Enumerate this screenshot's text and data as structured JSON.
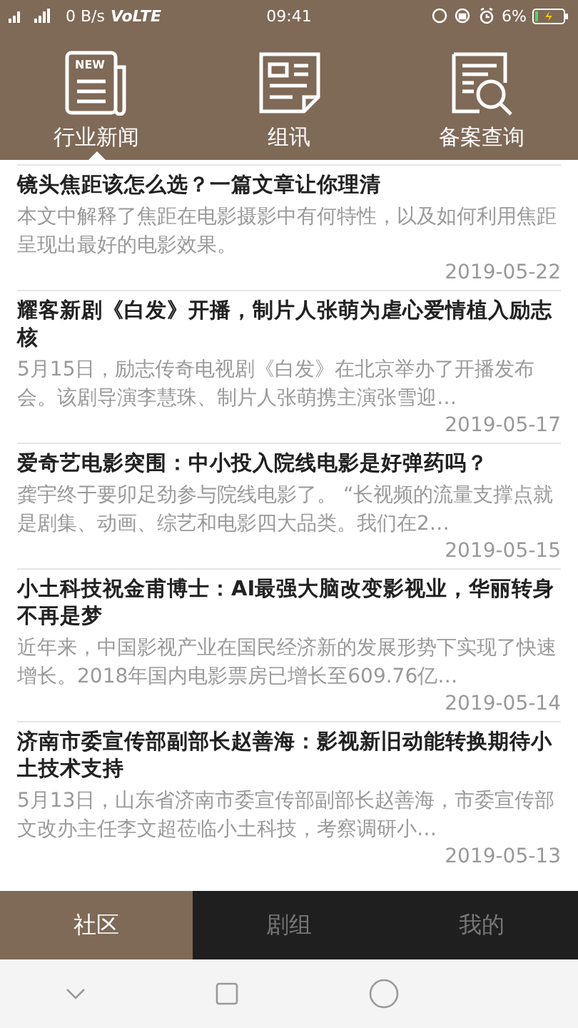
{
  "status_bar": {
    "speed": "0 B/s",
    "network": "VoLTE",
    "time": "09:41",
    "battery": "6%"
  },
  "top_tabs": [
    {
      "label": "行业新闻",
      "icon_text": "NEW",
      "selected": true
    },
    {
      "label": "组讯",
      "selected": false
    },
    {
      "label": "备案查询",
      "selected": false
    }
  ],
  "articles": [
    {
      "title": "镜头焦距该怎么选？一篇文章让你理清",
      "summary": "本文中解释了焦距在电影摄影中有何特性，以及如何利用焦距呈现出最好的电影效果。",
      "date": "2019-05-22"
    },
    {
      "title": "耀客新剧《白发》开播，制片人张萌为虐心爱情植入励志核",
      "summary": "5月15日，励志传奇电视剧《白发》在北京举办了开播发布会。该剧导演李慧珠、制片人张萌携主演张雪迎…",
      "date": "2019-05-17"
    },
    {
      "title": "爱奇艺电影突围：中小投入院线电影是好弹药吗？",
      "summary": "龚宇终于要卯足劲参与院线电影了。 “长视频的流量支撑点就是剧集、动画、综艺和电影四大品类。我们在2…",
      "date": "2019-05-15"
    },
    {
      "title": "小土科技祝金甫博士：AI最强大脑改变影视业，华丽转身不再是梦",
      "summary": "近年来，中国影视产业在国民经济新的发展形势下实现了快速增长。2018年国内电影票房已增长至609.76亿…",
      "date": "2019-05-14"
    },
    {
      "title": "济南市委宣传部副部长赵善海：影视新旧动能转换期待小土技术支持",
      "summary": "5月13日，山东省济南市委宣传部副部长赵善海，市委宣传部文改办主任李文超莅临小土科技，考察调研小…",
      "date": "2019-05-13"
    }
  ],
  "bottom_tabs": [
    {
      "label": "社区",
      "selected": true
    },
    {
      "label": "剧组",
      "selected": false
    },
    {
      "label": "我的",
      "selected": false
    }
  ]
}
